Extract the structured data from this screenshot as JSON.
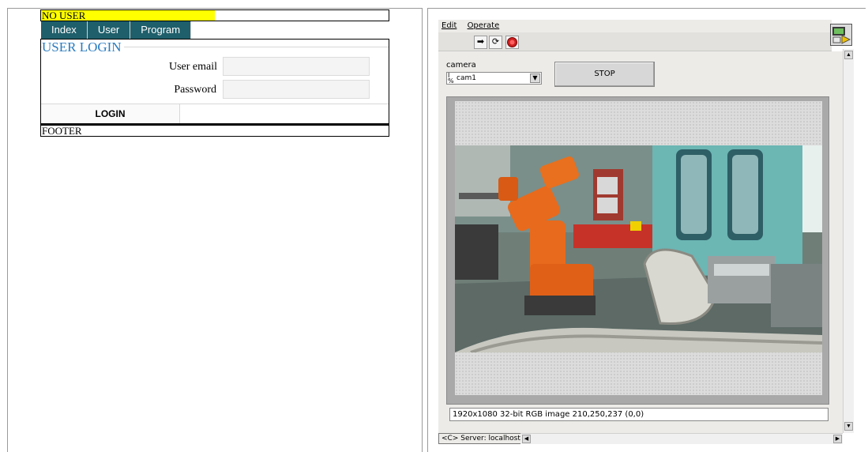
{
  "web": {
    "user_status": "NO USER",
    "tabs": [
      "Index",
      "User",
      "Program"
    ],
    "login_title": "USER LOGIN",
    "email_label": "User email",
    "email_value": "",
    "password_label": "Password",
    "password_value": "",
    "login_button": "LOGIN",
    "footer": "FOOTER"
  },
  "labview": {
    "menu": {
      "edit": "Edit",
      "operate": "Operate"
    },
    "toolbar_icons": [
      "run-arrow-icon",
      "run-continuous-icon",
      "abort-icon"
    ],
    "camera_label": "camera",
    "camera_value": "cam1",
    "stop_label": "STOP",
    "status_text": "1920x1080 32-bit RGB image 210,250,237    (0,0)",
    "server_label": "<C> Server: localhost"
  },
  "colors": {
    "tab_bg": "#1f5f6b",
    "user_highlight": "#ffff00",
    "login_title": "#2a7bbf",
    "panel_bg": "#ecebe8"
  }
}
